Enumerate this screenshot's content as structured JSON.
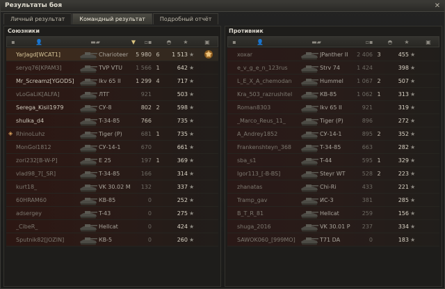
{
  "window": {
    "title": "Результаты боя",
    "close_glyph": "✕"
  },
  "tabs": [
    {
      "label": "Личный результат",
      "active": false
    },
    {
      "label": "Командный результат",
      "active": true
    },
    {
      "label": "Подробный отчёт",
      "active": false
    }
  ],
  "allies": {
    "title": "Союзники",
    "rows": [
      {
        "name": "YarJagd[WCAT1]",
        "tank": "Charioteer",
        "damage": "5 980",
        "kills": "6",
        "exp": "1 513",
        "state": "me",
        "medal": true,
        "platoon": false
      },
      {
        "name": "seryq76[KPAM3]",
        "tank": "TVP VTU",
        "damage": "1 566",
        "kills": "1",
        "exp": "642",
        "state": "dead",
        "medal": false,
        "platoon": false
      },
      {
        "name": "Mr_Screamz[YGODS]",
        "tank": "Ikv 65 II",
        "damage": "1 299",
        "kills": "4",
        "exp": "717",
        "state": "alive",
        "medal": false,
        "platoon": false
      },
      {
        "name": "vLoGaLiK[ALFA]",
        "tank": "ЛТГ",
        "damage": "921",
        "kills": "",
        "exp": "503",
        "state": "dead",
        "medal": false,
        "platoon": false
      },
      {
        "name": "Serega_Kisil1979",
        "tank": "СУ-8",
        "damage": "802",
        "kills": "2",
        "exp": "598",
        "state": "alive",
        "medal": false,
        "platoon": false
      },
      {
        "name": "shulka_d4",
        "tank": "T-34-85",
        "damage": "766",
        "kills": "",
        "exp": "735",
        "state": "alive",
        "medal": false,
        "platoon": false
      },
      {
        "name": "RhinoLuhz",
        "tank": "Tiger (P)",
        "damage": "681",
        "kills": "1",
        "exp": "735",
        "state": "dead",
        "medal": false,
        "platoon": true
      },
      {
        "name": "MonGol1812",
        "tank": "СУ-14-1",
        "damage": "670",
        "kills": "",
        "exp": "661",
        "state": "dead",
        "medal": false,
        "platoon": false
      },
      {
        "name": "zori232[B-W-P]",
        "tank": "E 25",
        "damage": "197",
        "kills": "1",
        "exp": "369",
        "state": "dead",
        "medal": false,
        "platoon": false
      },
      {
        "name": "vlad98_7[_SR]",
        "tank": "T-34-85",
        "damage": "166",
        "kills": "",
        "exp": "314",
        "state": "dead",
        "medal": false,
        "platoon": false
      },
      {
        "name": "kurt18_",
        "tank": "VK 30.02 M",
        "damage": "132",
        "kills": "",
        "exp": "337",
        "state": "dead",
        "medal": false,
        "platoon": false
      },
      {
        "name": "60HRAM60",
        "tank": "КВ-85",
        "damage": "0",
        "kills": "",
        "exp": "252",
        "state": "dead",
        "medal": false,
        "platoon": false
      },
      {
        "name": "adsergey",
        "tank": "T-43",
        "damage": "0",
        "kills": "",
        "exp": "275",
        "state": "dead",
        "medal": false,
        "platoon": false
      },
      {
        "name": "_CibeR_",
        "tank": "Hellcat",
        "damage": "0",
        "kills": "",
        "exp": "424",
        "state": "dead",
        "medal": false,
        "platoon": false
      },
      {
        "name": "Sputnik82[JOZIN]",
        "tank": "КВ-5",
        "damage": "0",
        "kills": "",
        "exp": "260",
        "state": "dead",
        "medal": false,
        "platoon": false
      }
    ]
  },
  "enemies": {
    "title": "Противник",
    "rows": [
      {
        "name": "xoxar",
        "tank": "JPanther II",
        "damage": "2 406",
        "kills": "3",
        "exp": "455",
        "state": "dead"
      },
      {
        "name": "e_v_g_e_n_123rus",
        "tank": "Strv 74",
        "damage": "1 424",
        "kills": "",
        "exp": "398",
        "state": "dead"
      },
      {
        "name": "L_E_X_A_chemodan",
        "tank": "Hummel",
        "damage": "1 067",
        "kills": "2",
        "exp": "507",
        "state": "dead"
      },
      {
        "name": "Kra_503_razrushitel",
        "tank": "КВ-85",
        "damage": "1 062",
        "kills": "1",
        "exp": "313",
        "state": "dead"
      },
      {
        "name": "Roman8303",
        "tank": "Ikv 65 II",
        "damage": "921",
        "kills": "",
        "exp": "319",
        "state": "dead"
      },
      {
        "name": "_Marco_Reus_11_",
        "tank": "Tiger (P)",
        "damage": "896",
        "kills": "",
        "exp": "272",
        "state": "dead"
      },
      {
        "name": "A_Andrey1852",
        "tank": "СУ-14-1",
        "damage": "895",
        "kills": "2",
        "exp": "352",
        "state": "dead"
      },
      {
        "name": "Frankenshteyn_368",
        "tank": "T-34-85",
        "damage": "663",
        "kills": "",
        "exp": "282",
        "state": "dead"
      },
      {
        "name": "sba_s1",
        "tank": "T-44",
        "damage": "595",
        "kills": "1",
        "exp": "329",
        "state": "dead"
      },
      {
        "name": "Igor113_[-B-BS]",
        "tank": "Steyr WT",
        "damage": "528",
        "kills": "2",
        "exp": "223",
        "state": "dead"
      },
      {
        "name": "zhanatas",
        "tank": "Chi-Ri",
        "damage": "433",
        "kills": "",
        "exp": "221",
        "state": "dead"
      },
      {
        "name": "Tramp_gav",
        "tank": "ИС-3",
        "damage": "381",
        "kills": "",
        "exp": "285",
        "state": "dead"
      },
      {
        "name": "B_T_R_81",
        "tank": "Hellcat",
        "damage": "259",
        "kills": "",
        "exp": "156",
        "state": "dead"
      },
      {
        "name": "shuga_2016",
        "tank": "VK 30.01 P",
        "damage": "237",
        "kills": "",
        "exp": "334",
        "state": "dead"
      },
      {
        "name": "SAWOK060_[999MO]",
        "tank": "T71 DA",
        "damage": "0",
        "kills": "",
        "exp": "183",
        "state": "dead"
      }
    ]
  },
  "icons": {
    "star": "★",
    "platoon": "◈",
    "sort_arrow": "▼"
  }
}
